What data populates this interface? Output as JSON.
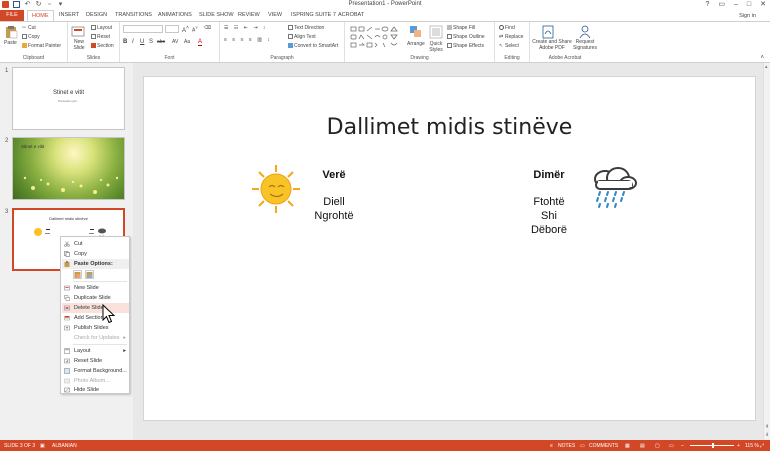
{
  "titlebar": {
    "title": "Presentation1 - PowerPoint",
    "controls": [
      "?",
      "▭",
      "–",
      "□",
      "✕"
    ]
  },
  "tabs": {
    "file": "FILE",
    "items": [
      "HOME",
      "INSERT",
      "DESIGN",
      "TRANSITIONS",
      "ANIMATIONS",
      "SLIDE SHOW",
      "REVIEW",
      "VIEW",
      "ISPRING SUITE 7",
      "ACROBAT"
    ],
    "sign_in": "Sign in"
  },
  "ribbon": {
    "clipboard": {
      "paste": "Paste",
      "cut": "Cut",
      "copy": "Copy",
      "format_painter": "Format Painter",
      "label": "Clipboard"
    },
    "slides": {
      "new_slide": "New Slide",
      "layout": "Layout",
      "reset": "Reset",
      "section": "Section",
      "label": "Slides"
    },
    "font": {
      "label": "Font",
      "bold": "B",
      "italic": "I",
      "underline": "U",
      "strike": "S",
      "abc": "abc",
      "av": "AV",
      "aa": "Aa",
      "a": "A"
    },
    "paragraph": {
      "label": "Paragraph",
      "text_direction": "Text Direction",
      "align_text": "Align Text",
      "convert": "Convert to SmartArt"
    },
    "drawing": {
      "label": "Drawing",
      "arrange": "Arrange",
      "quick_styles": "Quick Styles",
      "shape_fill": "Shape Fill",
      "shape_outline": "Shape Outline",
      "shape_effects": "Shape Effects"
    },
    "editing": {
      "label": "Editing",
      "find": "Find",
      "replace": "Replace",
      "select": "Select"
    },
    "acrobat": {
      "label": "Adobe Acrobat",
      "create_share": "Create and Share Adobe PDF",
      "request_sig": "Request Signatures"
    }
  },
  "thumbnails": {
    "slide1": {
      "num": "1",
      "title": "Stinet e vitit",
      "sub": "Prezantim për..."
    },
    "slide2": {
      "num": "2",
      "title": "Stinet e vitit"
    },
    "slide3": {
      "num": "3",
      "title": "Dallimet midis stinëve"
    }
  },
  "slide": {
    "title": "Dallimet midis stinëve",
    "summer_heading": "Verë",
    "summer_items": [
      "Diell",
      "Ngrohtë"
    ],
    "winter_heading": "Dimër",
    "winter_items": [
      "Ftohtë",
      "Shi",
      "Dëborë"
    ]
  },
  "context_menu": {
    "cut": "Cut",
    "copy": "Copy",
    "paste_options": "Paste Options:",
    "new_slide": "New Slide",
    "duplicate_slide": "Duplicate Slide",
    "delete_slide": "Delete Slide",
    "add_section": "Add Section",
    "publish_slides": "Publish Slides",
    "check_updates": "Check for Updates",
    "layout": "Layout",
    "reset_slide": "Reset Slide",
    "format_background": "Format Background...",
    "photo_album": "Photo Album...",
    "hide_slide": "Hide Slide"
  },
  "statusbar": {
    "slide_of": "SLIDE 3 OF 3",
    "language": "ALBANIAN",
    "notes": "NOTES",
    "comments": "COMMENTS",
    "zoom": "115 %"
  },
  "colors": {
    "accent": "#d24726",
    "sun": "#f7c326",
    "cloud": "#3b3b3b",
    "rain": "#2e88c7",
    "highlight": "#fbe1db"
  }
}
